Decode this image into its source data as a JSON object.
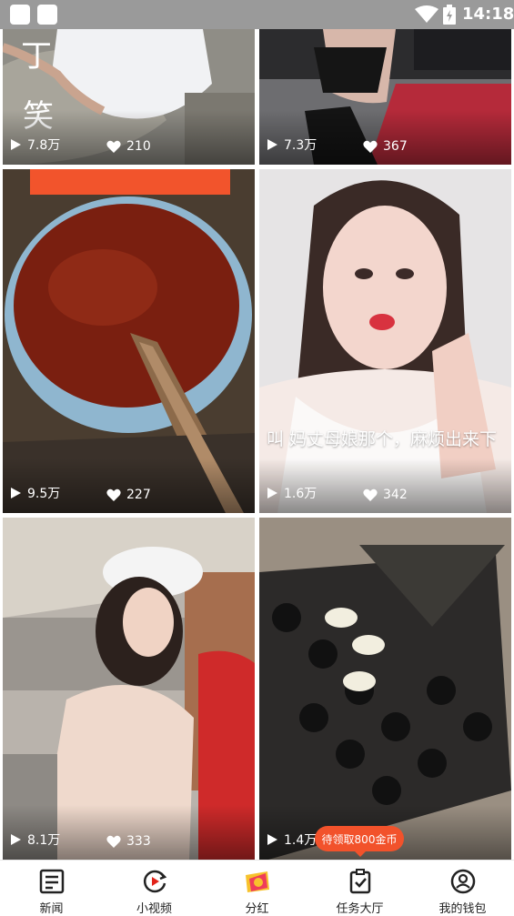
{
  "status_bar": {
    "time": "14:18"
  },
  "feed": {
    "videos": [
      {
        "plays": "7.8万",
        "likes": "210",
        "overlay_chars": [
          "丁",
          "笑"
        ]
      },
      {
        "plays": "7.3万",
        "likes": "367"
      },
      {
        "plays": "9.5万",
        "likes": "227"
      },
      {
        "plays": "1.6万",
        "likes": "342",
        "caption": "叫 妈丈母娘那个，麻烦出来下"
      },
      {
        "plays": "8.1万",
        "likes": "333"
      },
      {
        "plays": "1.4万",
        "likes": ""
      }
    ]
  },
  "promo_tooltip": "待领取800金币",
  "tab_bar": {
    "tabs": [
      {
        "label": "新闻",
        "icon": "news-icon"
      },
      {
        "label": "小视频",
        "icon": "short-video-icon"
      },
      {
        "label": "分红",
        "icon": "dividend-icon"
      },
      {
        "label": "任务大厅",
        "icon": "task-icon"
      },
      {
        "label": "我的钱包",
        "icon": "wallet-icon"
      }
    ]
  }
}
